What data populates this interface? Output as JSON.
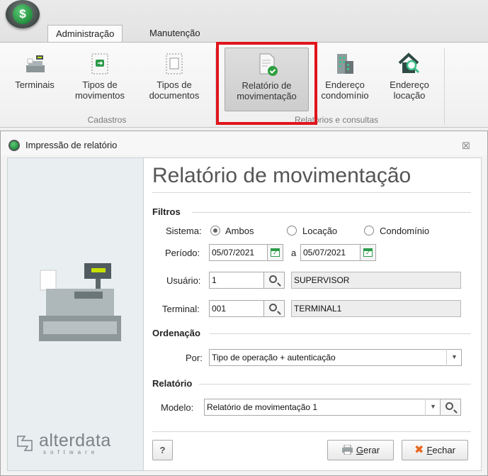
{
  "ribbon": {
    "tabs": [
      {
        "label": "Administração"
      },
      {
        "label": "Manutenção"
      }
    ],
    "buttons": {
      "terminais": "Terminais",
      "tipos_mov_1": "Tipos de",
      "tipos_mov_2": "movimentos",
      "tipos_doc_1": "Tipos de",
      "tipos_doc_2": "documentos",
      "rel_mov_1": "Relatório de",
      "rel_mov_2": "movimentação",
      "end_cond_1": "Endereço",
      "end_cond_2": "condomínio",
      "end_loc_1": "Endereço",
      "end_loc_2": "locação"
    },
    "groups": {
      "cadastros": "Cadastros",
      "relatorios": "Relatórios e consultas"
    }
  },
  "dialog": {
    "title": "Impressão de relatório",
    "close_glyph": "☒",
    "heading": "Relatório de movimentação",
    "filtros": {
      "section": "Filtros",
      "sistema_label": "Sistema:",
      "options": [
        "Ambos",
        "Locação",
        "Condomínio"
      ],
      "selected": "Ambos",
      "periodo_label": "Período:",
      "date_from": "05/07/2021",
      "date_sep": "a",
      "date_to": "05/07/2021",
      "usuario_label": "Usuário:",
      "usuario_code": "1",
      "usuario_name": "SUPERVISOR",
      "terminal_label": "Terminal:",
      "terminal_code": "001",
      "terminal_name": "TERMINAL1"
    },
    "ordenacao": {
      "section": "Ordenação",
      "por_label": "Por:",
      "por_value": "Tipo de operação + autenticação"
    },
    "relatorio": {
      "section": "Relatório",
      "modelo_label": "Modelo:",
      "modelo_value": "Relatório de movimentação 1"
    },
    "help_label": "?",
    "gerar_key": "G",
    "gerar_rest": "erar",
    "fechar_key": "F",
    "fechar_rest": "echar",
    "brand": {
      "name": "alterdata",
      "sub": "software"
    }
  },
  "colors": {
    "highlight": "#e0141b",
    "brand_green": "#1f8d3b"
  }
}
